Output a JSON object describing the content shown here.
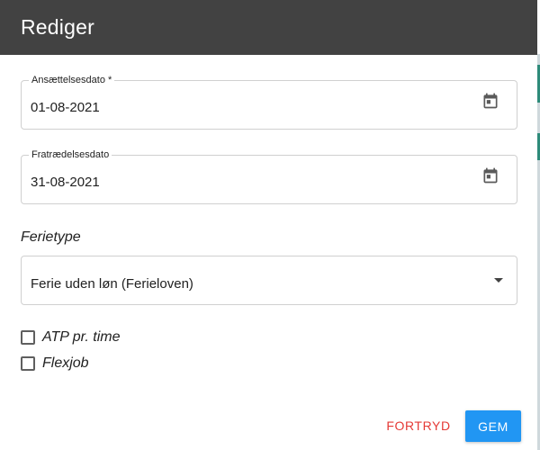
{
  "dialog": {
    "title": "Rediger"
  },
  "fields": {
    "employment_date": {
      "label": "Ansættelsesdato *",
      "value": "01-08-2021",
      "icon": "calendar-icon"
    },
    "resignation_date": {
      "label": "Fratrædelsesdato",
      "value": "31-08-2021",
      "icon": "calendar-icon"
    }
  },
  "vacation": {
    "section_label": "Ferietype",
    "selected": "Ferie uden løn (Ferieloven)",
    "icon": "dropdown-arrow-icon"
  },
  "checkboxes": {
    "atp": {
      "label": "ATP pr. time",
      "checked": false
    },
    "flexjob": {
      "label": "Flexjob",
      "checked": false
    }
  },
  "actions": {
    "cancel_label": "FORTRYD",
    "save_label": "GEM"
  },
  "colors": {
    "header_bg": "#424242",
    "primary": "#2196f3",
    "cancel": "#e53935",
    "side_accent": "#2e8b7a"
  }
}
